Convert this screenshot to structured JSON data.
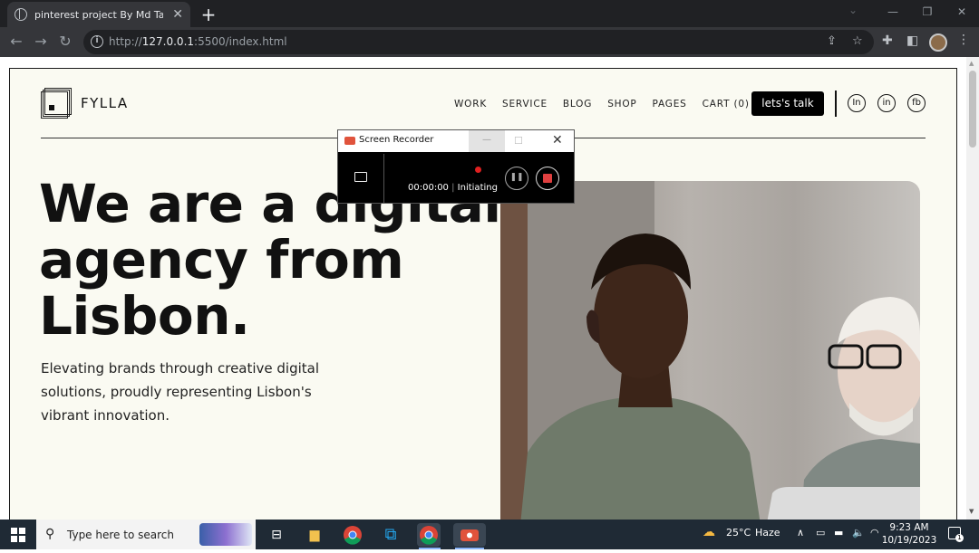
{
  "browser": {
    "tab_title": "pinterest project By Md Taufique",
    "url_prefix": "http://",
    "url_host": "127.0.0.1",
    "url_rest": ":5500/index.html"
  },
  "site": {
    "logo_text": "FYLLA",
    "nav": [
      "WORK",
      "SERVICE",
      "BLOG",
      "SHOP",
      "PAGES",
      "CART (0)"
    ],
    "cta": "lets's talk",
    "social": [
      "In",
      "in",
      "fb"
    ],
    "headline_lines": [
      "We are a digital",
      "agency from",
      "Lisbon."
    ],
    "subtext_lines": [
      "Elevating brands through creative digital",
      "solutions, proudly representing Lisbon's",
      "vibrant innovation."
    ]
  },
  "recorder": {
    "title": "Screen Recorder",
    "time": "00:00:00",
    "separator": "|",
    "status": "Initiating"
  },
  "taskbar": {
    "search_placeholder": "Type here to search",
    "weather_temp": "25°C",
    "weather_desc": "Haze",
    "time": "9:23 AM",
    "date": "10/19/2023",
    "notification_count": "1"
  }
}
